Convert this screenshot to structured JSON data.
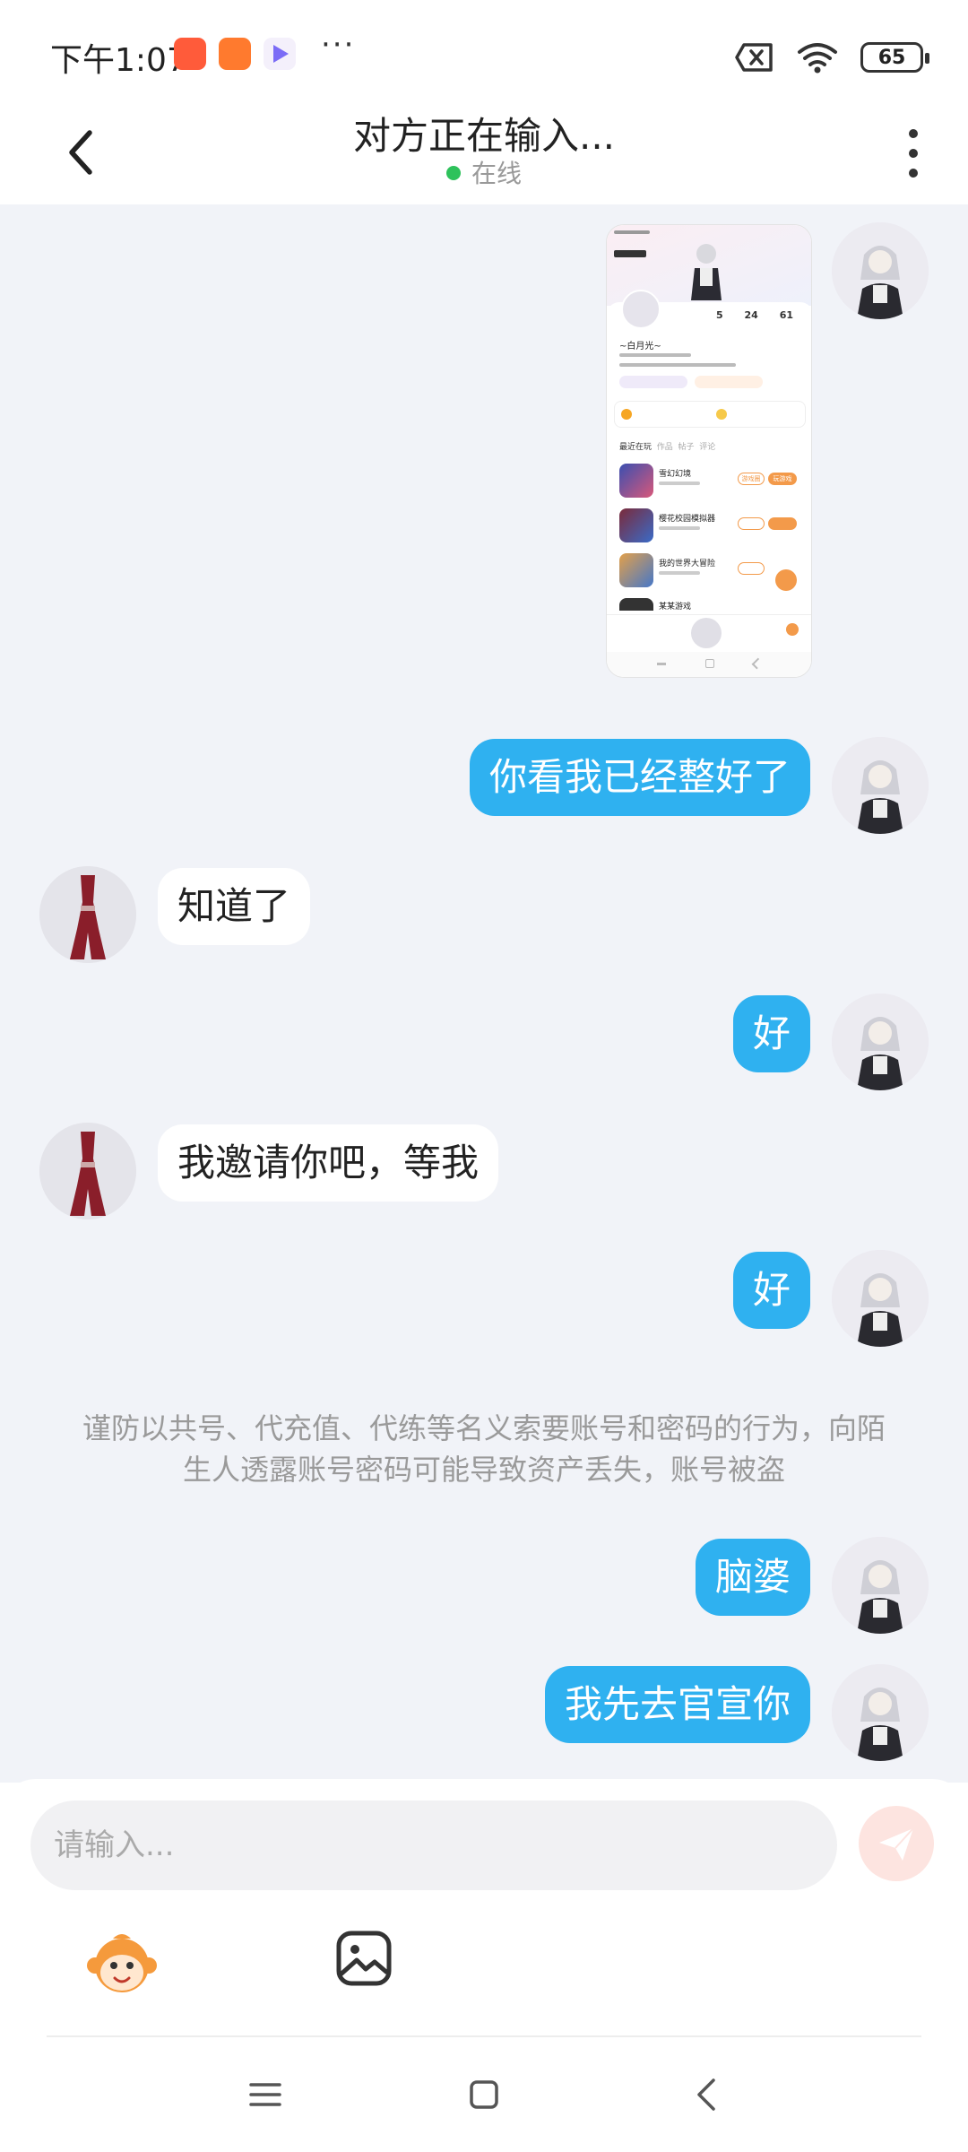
{
  "status_bar": {
    "time": "下午1:07",
    "more_dots": "···",
    "battery": "65"
  },
  "header": {
    "title": "对方正在输入...",
    "status": "在线"
  },
  "messages": [
    {
      "from": "self",
      "type": "image"
    },
    {
      "from": "self",
      "type": "text",
      "text": "你看我已经整好了"
    },
    {
      "from": "other",
      "type": "text",
      "text": "知道了"
    },
    {
      "from": "self",
      "type": "text",
      "text": "好"
    },
    {
      "from": "other",
      "type": "text",
      "text": "我邀请你吧，等我"
    },
    {
      "from": "self",
      "type": "text",
      "text": "好"
    },
    {
      "from": "self",
      "type": "text",
      "text": "脑婆"
    },
    {
      "from": "self",
      "type": "text",
      "text": "我先去官宣你"
    }
  ],
  "notice": "谨防以共号、代充值、代练等名义索要账号和密码的行为，向陌生人透露账号密码可能导致资产丢失，账号被盗",
  "input": {
    "placeholder": "请输入..."
  },
  "screenshot_preview": {
    "stats": [
      "5",
      "24",
      "61"
    ],
    "username": "~白月光~",
    "tabs": [
      "最近在玩",
      "作品",
      "帖子",
      "评论"
    ],
    "games": [
      "雪幻幻境",
      "樱花校园模拟器",
      "我的世界大冒险",
      "某某游戏"
    ],
    "buttons": [
      "游戏圈",
      "玩游戏"
    ]
  },
  "colors": {
    "self_bubble": "#2fb1f0",
    "other_bubble": "#ffffff",
    "chat_bg": "#f1f3f8",
    "online": "#2ec25b",
    "send_disabled": "#fde4e0"
  }
}
